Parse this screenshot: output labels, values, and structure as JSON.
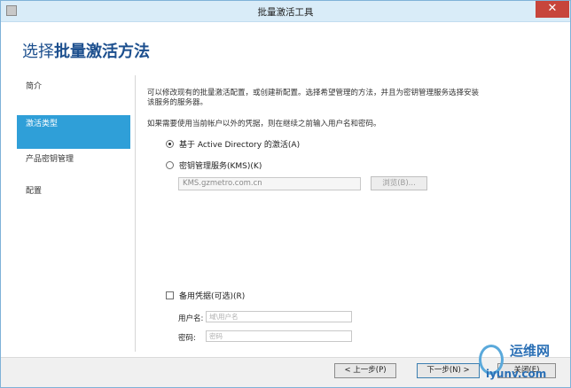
{
  "window": {
    "title": "批量激活工具",
    "close_glyph": "✕"
  },
  "page": {
    "heading_prefix": "选择",
    "heading_bold": "批量激活方法"
  },
  "sidebar": {
    "items": [
      {
        "label": "简介",
        "active": false
      },
      {
        "label": "激活类型",
        "active": true
      },
      {
        "label": "产品密钥管理",
        "active": false
      },
      {
        "label": "配置",
        "active": false
      }
    ]
  },
  "content": {
    "description_line1": "可以修改现有的批量激活配置，或创建新配置。选择希望管理的方法，并且为密钥管理服务选择安装",
    "description_line2": "该服务的服务器。",
    "credentials_note": "如果需要使用当前帐户以外的凭据，则在继续之前输入用户名和密码。",
    "options": [
      {
        "label": "基于 Active Directory 的激活(A)",
        "selected": true
      },
      {
        "label": "密钥管理服务(KMS)(K)",
        "selected": false
      }
    ],
    "kms_server_value": "KMS.gzmetro.com.cn",
    "browse_label": "浏览(B)...",
    "alternate_credentials_label": "备用凭据(可选)(R)",
    "alternate_credentials_checked": false,
    "username_label": "用户名:",
    "username_placeholder": "域\\用户名",
    "password_label": "密码:",
    "password_placeholder": "密码"
  },
  "footer": {
    "back_label": "< 上一步(P)",
    "next_label": "下一步(N) >",
    "close_label": "关闭(E)"
  },
  "watermark": {
    "text": "运维网",
    "url": "iyunv.com"
  },
  "colors": {
    "accent": "#2f9fd8",
    "heading": "#1c4f8e",
    "titlebar": "#d9ecf8",
    "close": "#c7453b"
  }
}
